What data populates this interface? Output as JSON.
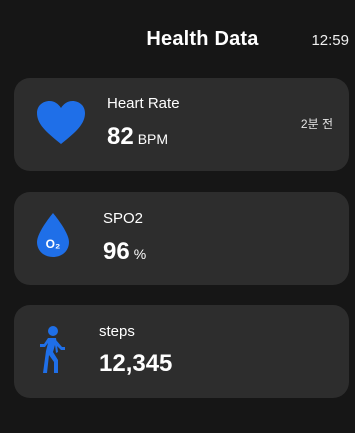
{
  "header": {
    "title": "Health Data",
    "time": "12:59"
  },
  "cards": {
    "heart_rate": {
      "label": "Heart Rate",
      "value": "82",
      "unit": "BPM",
      "ago": "2분 전",
      "icon": "heart-icon",
      "icon_color": "#1f6fe8"
    },
    "spo2": {
      "label": "SPO2",
      "value": "96",
      "unit": "%",
      "icon": "oxygen-drop-icon",
      "icon_text": "O₂",
      "icon_color": "#1f6fe8"
    },
    "steps": {
      "label": "steps",
      "value": "12,345",
      "icon": "walking-person-icon",
      "icon_color": "#1f6fe8"
    }
  },
  "colors": {
    "background": "#161616",
    "card": "#2d2d2d",
    "accent": "#1f6fe8"
  }
}
